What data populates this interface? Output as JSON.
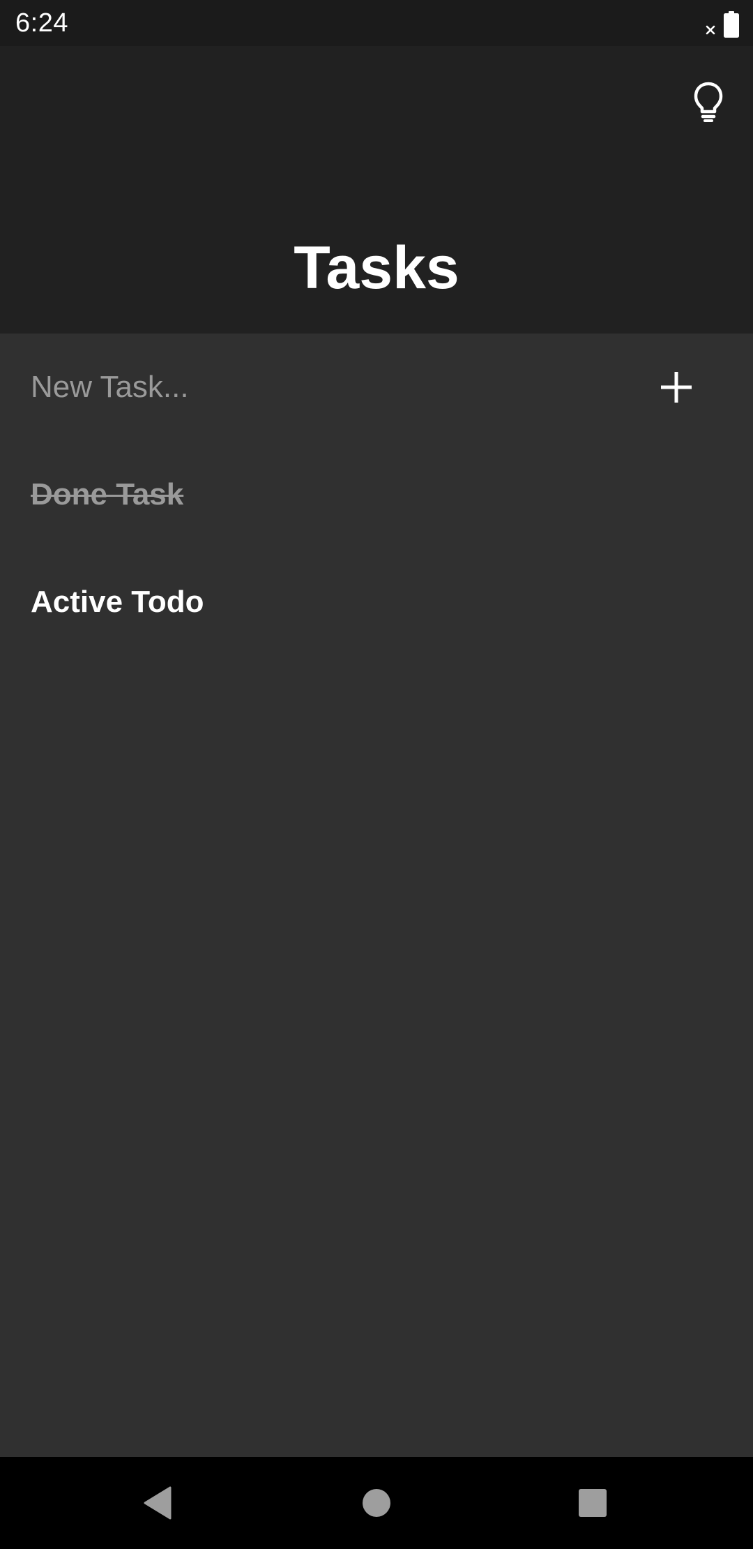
{
  "status_bar": {
    "time": "6:24",
    "icons": [
      "no-signal-icon",
      "battery-icon"
    ]
  },
  "header": {
    "title": "Tasks",
    "theme_icon": "lightbulb-icon"
  },
  "new_task": {
    "placeholder": "New Task...",
    "value": "",
    "add_icon": "plus-icon"
  },
  "tasks": [
    {
      "label": "Done Task",
      "status": "done"
    },
    {
      "label": "Active Todo",
      "status": "active"
    }
  ],
  "nav_bar": {
    "buttons": [
      "back-icon",
      "home-icon",
      "recents-icon"
    ]
  },
  "colors": {
    "status_bar_bg": "#1b1b1b",
    "app_bar_bg": "#212121",
    "content_bg": "#303030",
    "nav_bar_bg": "#000000",
    "text_primary": "#ffffff",
    "text_muted": "#9a9a9a"
  }
}
